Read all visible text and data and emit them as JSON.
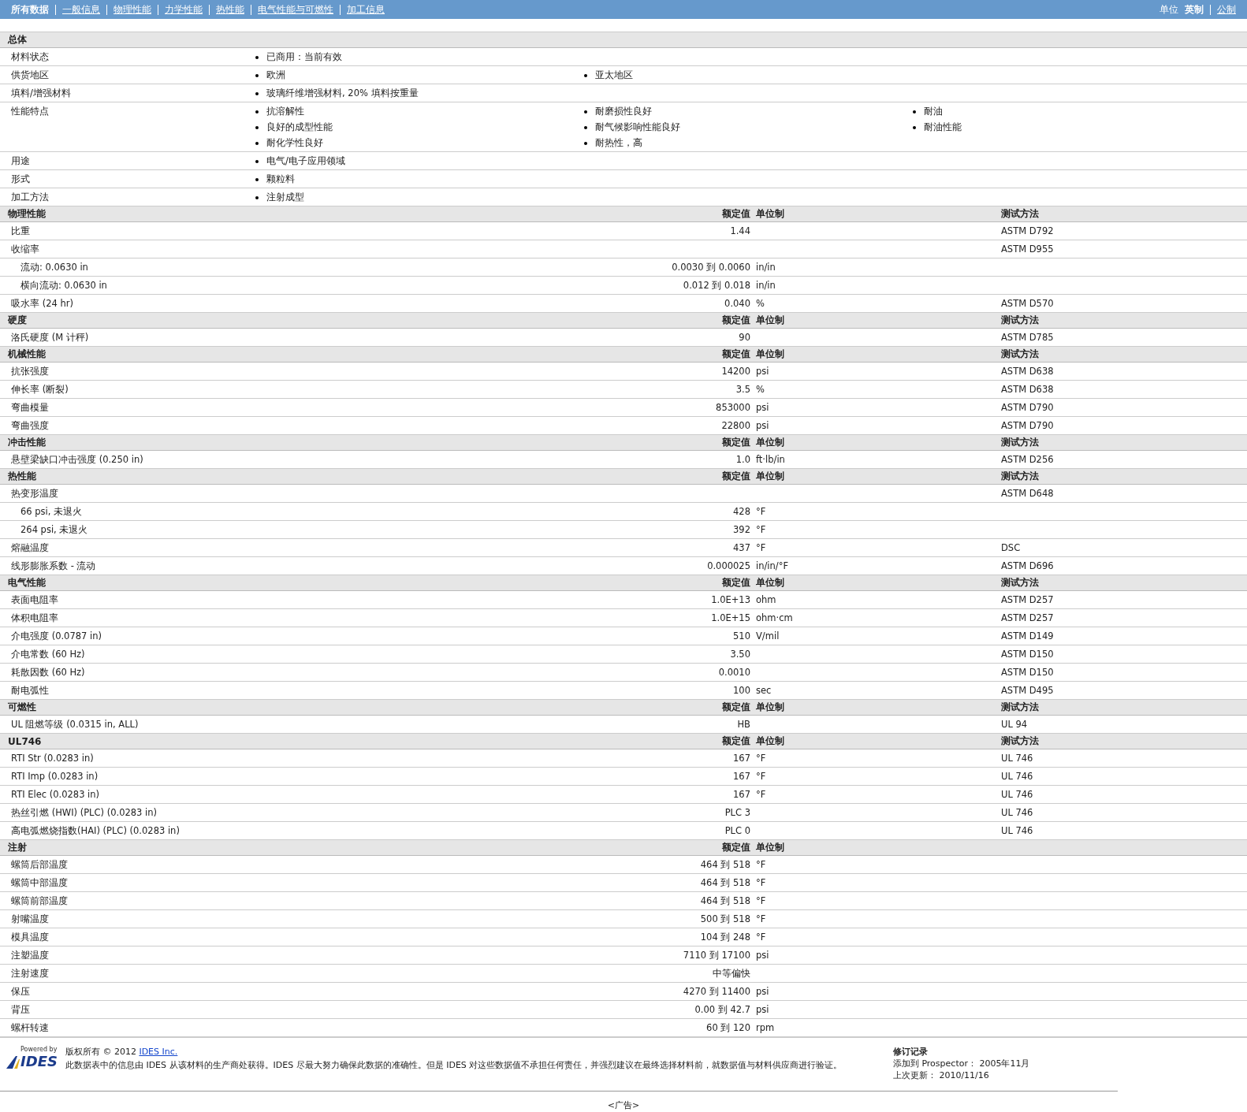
{
  "nav": {
    "tabs": [
      {
        "label": "所有数据",
        "selected": true
      },
      {
        "label": "一般信息",
        "selected": false
      },
      {
        "label": "物理性能",
        "selected": false
      },
      {
        "label": "力学性能",
        "selected": false
      },
      {
        "label": "热性能",
        "selected": false
      },
      {
        "label": "电气性能与可燃性",
        "selected": false
      },
      {
        "label": "加工信息",
        "selected": false
      }
    ],
    "units_label": "单位",
    "units": [
      {
        "label": "英制",
        "selected": true
      },
      {
        "label": "公制",
        "selected": false
      }
    ]
  },
  "general": {
    "title": "总体",
    "rows": [
      {
        "label": "材料状态",
        "values": [
          "已商用：当前有效"
        ]
      },
      {
        "label": "供货地区",
        "values": [
          "欧洲",
          "亚太地区"
        ]
      },
      {
        "label": "填料/增强材料",
        "values": [
          "玻璃纤维增强材料, 20% 填料按重量"
        ]
      },
      {
        "label": "性能特点",
        "values": [
          "抗溶解性",
          "耐磨损性良好",
          "耐油",
          "良好的成型性能",
          "耐气候影响性能良好",
          "耐油性能",
          "耐化学性良好",
          "耐热性，高"
        ]
      },
      {
        "label": "用途",
        "values": [
          "电气/电子应用领域"
        ]
      },
      {
        "label": "形式",
        "values": [
          "颗粒料"
        ]
      },
      {
        "label": "加工方法",
        "values": [
          "注射成型"
        ]
      }
    ]
  },
  "sections": [
    {
      "title": "物理性能",
      "value_header": "额定值",
      "unit_header": "单位制",
      "method_header": "测试方法",
      "rows": [
        {
          "name": "比重",
          "value": "1.44",
          "method": "ASTM D792"
        },
        {
          "name": "收缩率",
          "method": "ASTM D955",
          "children": [
            {
              "name": "流动: 0.0630 in",
              "value": "0.0030 到  0.0060",
              "unit": "in/in"
            },
            {
              "name": "横向流动: 0.0630 in",
              "value": "0.012 到  0.018",
              "unit": "in/in"
            }
          ]
        },
        {
          "name": "吸水率  (24 hr)",
          "value": "0.040",
          "unit": "%",
          "method": "ASTM D570"
        }
      ]
    },
    {
      "title": "硬度",
      "value_header": "额定值",
      "unit_header": "单位制",
      "method_header": "测试方法",
      "rows": [
        {
          "name": "洛氏硬度  (M 计秤)",
          "value": "90",
          "method": "ASTM D785"
        }
      ]
    },
    {
      "title": "机械性能",
      "value_header": "额定值",
      "unit_header": "单位制",
      "method_header": "测试方法",
      "rows": [
        {
          "name": "抗张强度",
          "value": "14200",
          "unit": "psi",
          "method": "ASTM D638"
        },
        {
          "name": "伸长率  (断裂)",
          "value": "3.5",
          "unit": "%",
          "method": "ASTM D638"
        },
        {
          "name": "弯曲模量",
          "value": "853000",
          "unit": "psi",
          "method": "ASTM D790"
        },
        {
          "name": "弯曲强度",
          "value": "22800",
          "unit": "psi",
          "method": "ASTM D790"
        }
      ]
    },
    {
      "title": "冲击性能",
      "value_header": "额定值",
      "unit_header": "单位制",
      "method_header": "测试方法",
      "rows": [
        {
          "name": "悬壁梁缺口冲击强度  (0.250 in)",
          "value": "1.0",
          "unit": "ft·lb/in",
          "method": "ASTM D256"
        }
      ]
    },
    {
      "title": "热性能",
      "value_header": "额定值",
      "unit_header": "单位制",
      "method_header": "测试方法",
      "rows": [
        {
          "name": "热变形温度",
          "method": "ASTM D648",
          "children": [
            {
              "name": "66 psi, 未退火",
              "value": "428",
              "unit": "°F"
            },
            {
              "name": "264 psi, 未退火",
              "value": "392",
              "unit": "°F"
            }
          ]
        },
        {
          "name": "熔融温度",
          "value": "437",
          "unit": "°F",
          "method": "DSC"
        },
        {
          "name": "线形膨胀系数  - 流动",
          "value": "0.000025",
          "unit": "in/in/°F",
          "method": "ASTM D696"
        }
      ]
    },
    {
      "title": "电气性能",
      "value_header": "额定值",
      "unit_header": "单位制",
      "method_header": "测试方法",
      "rows": [
        {
          "name": "表面电阻率",
          "value": "1.0E+13",
          "unit": "ohm",
          "method": "ASTM D257"
        },
        {
          "name": "体积电阻率",
          "value": "1.0E+15",
          "unit": "ohm·cm",
          "method": "ASTM D257"
        },
        {
          "name": "介电强度  (0.0787 in)",
          "value": "510",
          "unit": "V/mil",
          "method": "ASTM D149"
        },
        {
          "name": "介电常数  (60 Hz)",
          "value": "3.50",
          "method": "ASTM D150"
        },
        {
          "name": "耗散因数  (60 Hz)",
          "value": "0.0010",
          "method": "ASTM D150"
        },
        {
          "name": "耐电弧性",
          "value": "100",
          "unit": "sec",
          "method": "ASTM D495"
        }
      ]
    },
    {
      "title": "可燃性",
      "value_header": "额定值",
      "unit_header": "单位制",
      "method_header": "测试方法",
      "rows": [
        {
          "name": "UL 阻燃等级  (0.0315 in, ALL)",
          "value": "HB",
          "method": "UL 94"
        }
      ]
    },
    {
      "title": "UL746",
      "value_header": "额定值",
      "unit_header": "单位制",
      "method_header": "测试方法",
      "rows": [
        {
          "name": "RTI Str (0.0283 in)",
          "value": "167",
          "unit": "°F",
          "method": "UL 746"
        },
        {
          "name": "RTI Imp (0.0283 in)",
          "value": "167",
          "unit": "°F",
          "method": "UL 746"
        },
        {
          "name": "RTI Elec (0.0283 in)",
          "value": "167",
          "unit": "°F",
          "method": "UL 746"
        },
        {
          "name": "热丝引燃  (HWI) (PLC) (0.0283 in)",
          "value": "PLC 3",
          "method": "UL 746"
        },
        {
          "name": "高电弧燃烧指数(HAI) (PLC) (0.0283 in)",
          "value": "PLC 0",
          "method": "UL 746"
        }
      ]
    },
    {
      "title": "注射",
      "value_header": "额定值",
      "unit_header": "单位制",
      "rows": [
        {
          "name": "螺筒后部温度",
          "value": "464 到  518",
          "unit": "°F"
        },
        {
          "name": "螺筒中部温度",
          "value": "464 到  518",
          "unit": "°F"
        },
        {
          "name": "螺筒前部温度",
          "value": "464 到  518",
          "unit": "°F"
        },
        {
          "name": "射嘴温度",
          "value": "500 到  518",
          "unit": "°F"
        },
        {
          "name": "模具温度",
          "value": "104 到  248",
          "unit": "°F"
        },
        {
          "name": "注塑温度",
          "value": "7110 到  17100",
          "unit": "psi"
        },
        {
          "name": "注射速度",
          "value": "中等偏快"
        },
        {
          "name": "保压",
          "value": "4270 到  11400",
          "unit": "psi"
        },
        {
          "name": "背压",
          "value": "0.00 到  42.7",
          "unit": "psi"
        },
        {
          "name": "螺杆转速",
          "value": "60 到  120",
          "unit": "rpm"
        }
      ]
    }
  ],
  "footer": {
    "logo_caption": "Powered by",
    "logo_name": "IDES",
    "copyright": "版权所有  © 2012",
    "copyright_link": "IDES Inc.",
    "disclaimer": "此数据表中的信息由  IDES 从该材料的生产商处获得。IDES 尽最大努力确保此数据的准确性。但是  IDES 对这些数据值不承担任何责任，并强烈建议在最终选择材料前，就数据值与材料供应商进行验证。",
    "revision_title": "修订记录",
    "added": "添加到 Prospector：  2005年11月",
    "updated": "上次更新：  2010/11/16"
  },
  "ad": "<广告>"
}
